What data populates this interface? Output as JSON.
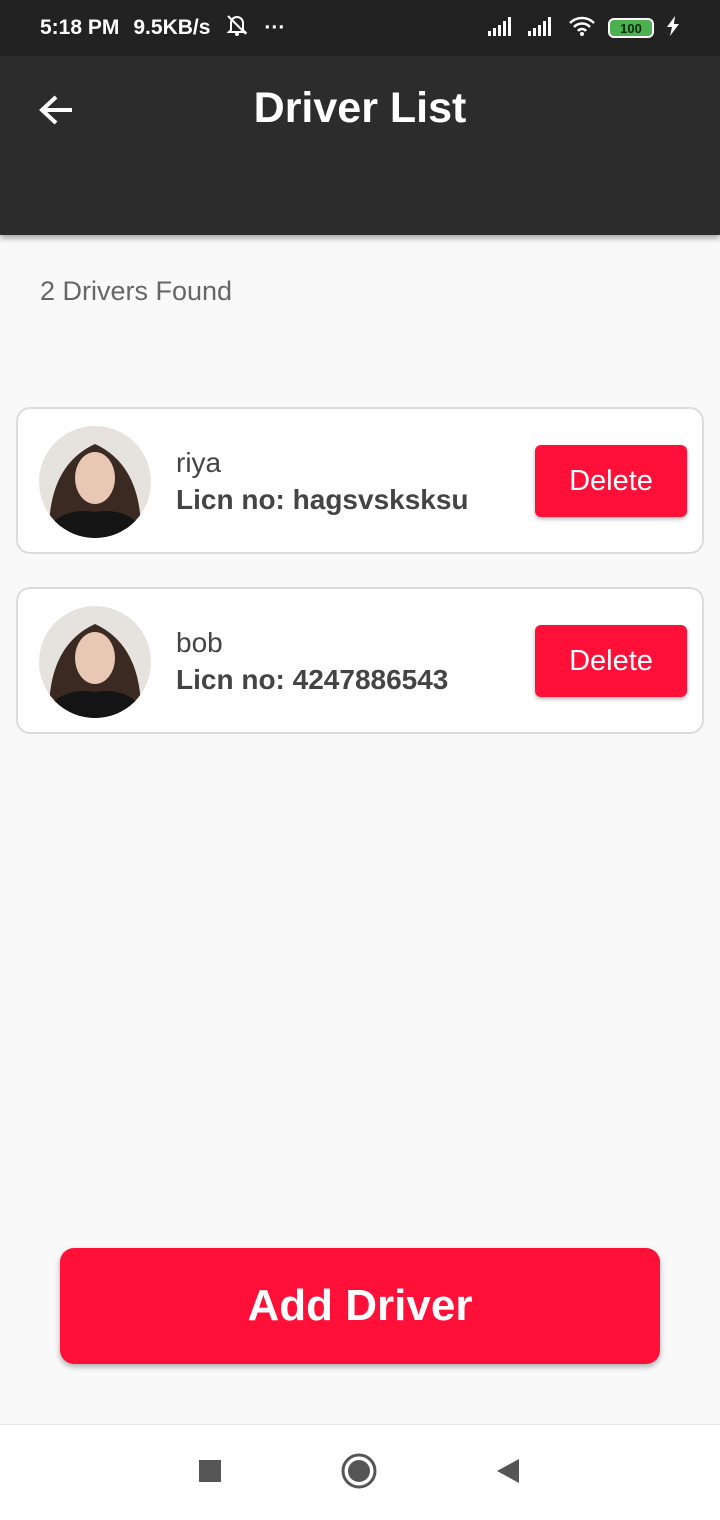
{
  "status_bar": {
    "time": "5:18 PM",
    "speed": "9.5KB/s",
    "more": "···",
    "battery": "100",
    "icons": [
      "bell-muted-icon",
      "signal-icon",
      "signal-icon",
      "wifi-icon",
      "battery-icon",
      "charging-icon"
    ]
  },
  "app_bar": {
    "title": "Driver List",
    "back_icon": "arrow-left-icon"
  },
  "summary": {
    "count_text": "2 Drivers Found"
  },
  "drivers": [
    {
      "name": "riya",
      "license": "Licn no: hagsvsksksu",
      "delete_label": "Delete"
    },
    {
      "name": "bob",
      "license": "Licn no: 4247886543",
      "delete_label": "Delete"
    }
  ],
  "add_button": {
    "label": "Add Driver"
  },
  "nav_bar": {
    "icons": [
      "recents-square-icon",
      "home-circle-icon",
      "back-triangle-icon"
    ]
  },
  "colors": {
    "accent": "#fe1039",
    "app_bar": "#2c2c2c",
    "status_bar": "#222222",
    "background": "#f9f9f9"
  }
}
